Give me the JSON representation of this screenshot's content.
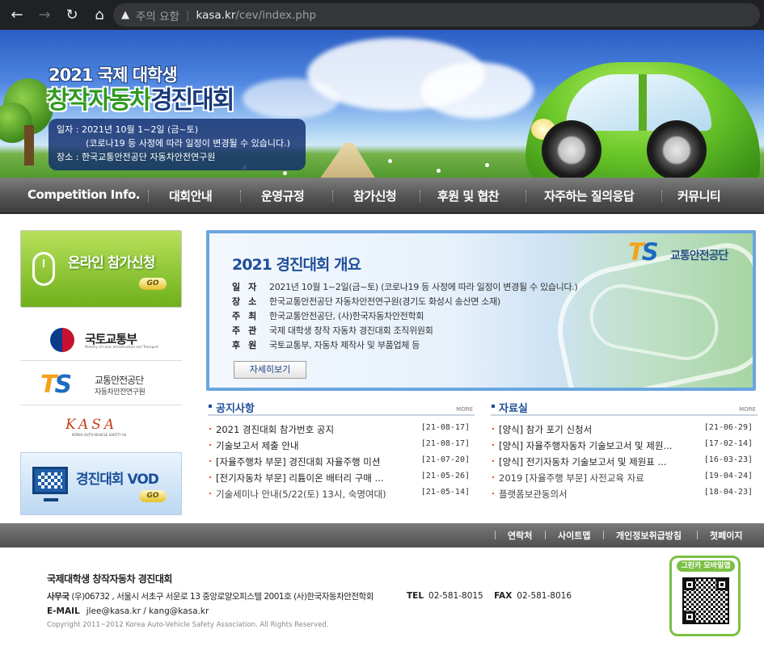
{
  "browser": {
    "warning": "주의 요함",
    "url_host": "kasa.kr",
    "url_path": "/cev/index.php"
  },
  "banner": {
    "title_line1": "2021 국제 대학생",
    "title_highlight": "창작자동차",
    "title_rest": "경진대회",
    "info_date": "일자 : 2021년 10월 1~2일 (금~토)",
    "info_note": "(코로나19 등 사정에 따라 일정이 변경될 수 있습니다.)",
    "info_place": "장소 : 한국교통안전공단 자동차안전연구원"
  },
  "nav": {
    "items": [
      "Competition Info.",
      "대회안내",
      "운영규정",
      "참가신청",
      "후원 및 협찬",
      "자주하는 질의응답",
      "커뮤니티"
    ]
  },
  "sidebar": {
    "online_label": "온라인 참가신청",
    "go": "GO",
    "molit_name": "국토교통부",
    "molit_sub": "Ministry of Land, Infrastructure and Transport",
    "ts_name": "교통안전공단",
    "ts_sub": "자동차안전연구원",
    "kasa_mark": "KASA",
    "kasa_sub": "KOREA AUTO-VEHICLE SAFETY AS",
    "vod_label": "경진대회 VOD"
  },
  "overview": {
    "title": "2021 경진대회 개요",
    "logo_name": "교통안전공단",
    "rows": [
      {
        "key": "일자",
        "value": "2021년 10월 1~2일(금~토) (코로나19 등 사정에 따라 일정이 변경될 수 있습니다.)"
      },
      {
        "key": "장소",
        "value": "한국교통안전공단 자동차안전연구원(경기도 화성시 송산면 소재)"
      },
      {
        "key": "주최",
        "value": "한국교통안전공단, (사)한국자동차안전학회"
      },
      {
        "key": "주관",
        "value": "국제 대학생 창작 자동차 경진대회 조직위원회"
      },
      {
        "key": "후원",
        "value": "국토교통부, 자동차 제작사 및 부품업체 등"
      }
    ],
    "detail_button": "자세히보기"
  },
  "notices": {
    "title": "공지사항",
    "more": "MORE",
    "items": [
      {
        "title": "2021 경진대회 참가번호 공지",
        "date": "[21-08-17]"
      },
      {
        "title": "기술보고서 제출 안내",
        "date": "[21-08-17]"
      },
      {
        "title": "[자율주행차 부문] 경진대회 자율주행 미션",
        "date": "[21-07-20]"
      },
      {
        "title": "[전기자동차 부문] 리튬이온 배터리 구매 ...",
        "date": "[21-05-26]"
      },
      {
        "title": "기술세미나 안내(5/22(토) 13시, 숙명여대)",
        "date": "[21-05-14]"
      }
    ]
  },
  "resources": {
    "title": "자료실",
    "more": "MORE",
    "items": [
      {
        "title": "[양식] 참가 포기 신청서",
        "date": "[21-06-29]"
      },
      {
        "title": "[양식] 자율주행자동차 기술보고서 및 제원...",
        "date": "[17-02-14]"
      },
      {
        "title": "[양식] 전기자동차 기술보고서 및 제원표 ...",
        "date": "[16-03-23]"
      },
      {
        "title": "2019 [자율주행 부문] 사전교육 자료",
        "date": "[19-04-24]"
      },
      {
        "title": "플랫폼보관동의서",
        "date": "[18-04-23]"
      }
    ]
  },
  "footer": {
    "links": [
      "연락처",
      "사이트맵",
      "개인정보취급방침",
      "첫페이지"
    ],
    "org_title": "국제대학생 창작자동차 경진대회",
    "addr_label": "사무국",
    "addr": "(우)06732 , 서울시 서초구 서운로 13 중앙로얄오피스텔 2001호  (사)한국자동차안전학회",
    "tel_label": "TEL",
    "tel": "02-581-8015",
    "fax_label": "FAX",
    "fax": "02-581-8016",
    "mail_label": "E-MAIL",
    "mail": "jlee@kasa.kr / kang@kasa.kr",
    "copyright": "Copyright 2011~2012 Korea Auto-Vehicle Safety Association. All Rights Reserved.",
    "qr_label": "그린카 모바일앱"
  }
}
